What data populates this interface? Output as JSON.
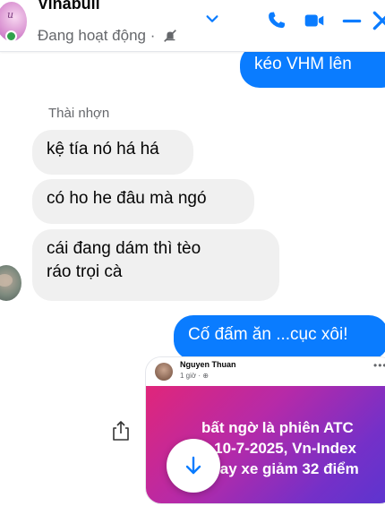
{
  "header": {
    "contact_name": "Vinabull",
    "status": "Đang hoạt động ·",
    "avatar_text": "u",
    "icons": [
      "chevron-down-icon",
      "phone-icon",
      "video-icon",
      "minimize-icon",
      "close-icon"
    ],
    "accent_color": "#0a7cff"
  },
  "messages": {
    "out_1": "kéo VHM lên",
    "sender_name": "Thài nhợn",
    "in_1": "kệ tía nó há há",
    "in_2": "có ho he đâu mà ngó",
    "in_3_line1": "cái đang dám thì tèo",
    "in_3_line2": "ráo trọi cà",
    "out_2": "Cố đấm ăn ...cục xôi!"
  },
  "shared_post": {
    "author": "Nguyen Thuan",
    "time": "1 giờ · ⊕",
    "more": "•••",
    "text_line1": "bất ngờ là phiên ATC",
    "text_line2": "y 10-7-2025, Vn-Index",
    "text_line3": "quay xe giảm 32 điểm"
  }
}
